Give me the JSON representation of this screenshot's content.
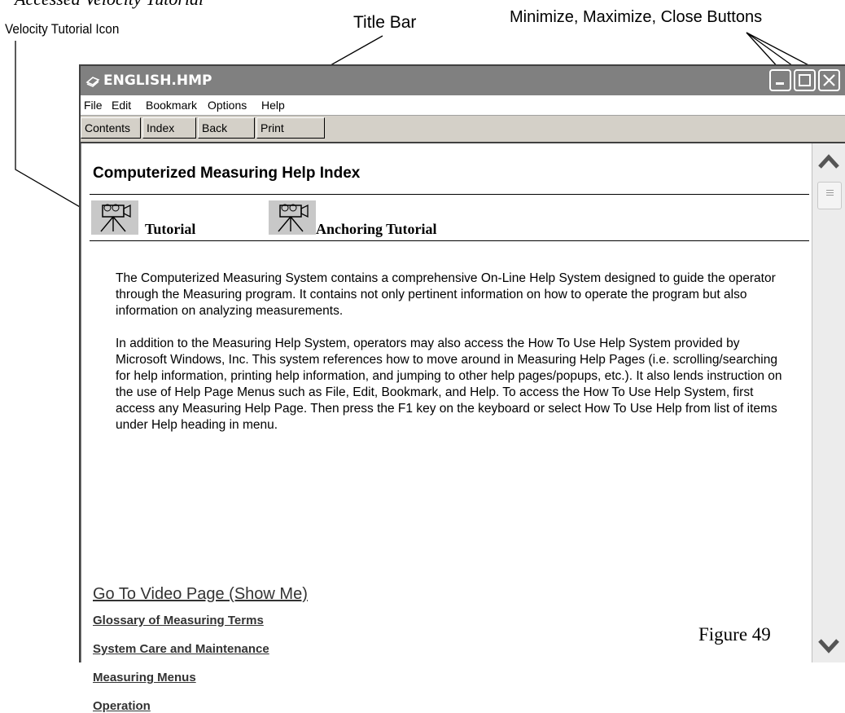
{
  "callouts": {
    "header_cut": "Accessed Velocity Tutorial",
    "velocity_icon": "Velocity Tutorial Icon",
    "title_bar": "Title Bar",
    "window_buttons": "Minimize, Maximize, Close Buttons"
  },
  "window": {
    "title": "ENGLISH.HMP",
    "menu": [
      "File",
      "Edit",
      "Bookmark",
      "Options",
      "Help"
    ],
    "toolbar": [
      "Contents",
      "Index",
      "Back",
      "Print"
    ]
  },
  "content": {
    "page_title": "Computerized Measuring Help Index",
    "tutorial_link": "Tutorial",
    "anchoring_link": "Anchoring Tutorial",
    "paragraph_1": "The Computerized Measuring System contains a comprehensive On-Line Help System designed to guide the operator through the Measuring program. It contains not only pertinent information on how to operate the program but also information on analyzing measurements.",
    "paragraph_2": "In addition to the Measuring Help System, operators may also access the How To Use Help System provided by Microsoft Windows, Inc. This system references how to move around in Measuring Help Pages (i.e. scrolling/searching for help information, printing help information, and jumping to other help pages/popups, etc.). It also lends instruction on the use of Help Page Menus such as File, Edit, Bookmark, and Help. To access the How To Use Help System, first access any Measuring Help Page. Then press the F1 key on the keyboard or select How To Use Help from list of items under Help heading in menu.",
    "video_link": "Go To Video Page (Show Me)",
    "links": [
      "Glossary of Measuring Terms",
      "System Care and Maintenance",
      "Measuring Menus",
      "Operation"
    ]
  },
  "figure_label": "Figure 49",
  "colors": {
    "title_bar": "#808080",
    "window_frame": "#d4d0c8",
    "link": "#333333"
  }
}
